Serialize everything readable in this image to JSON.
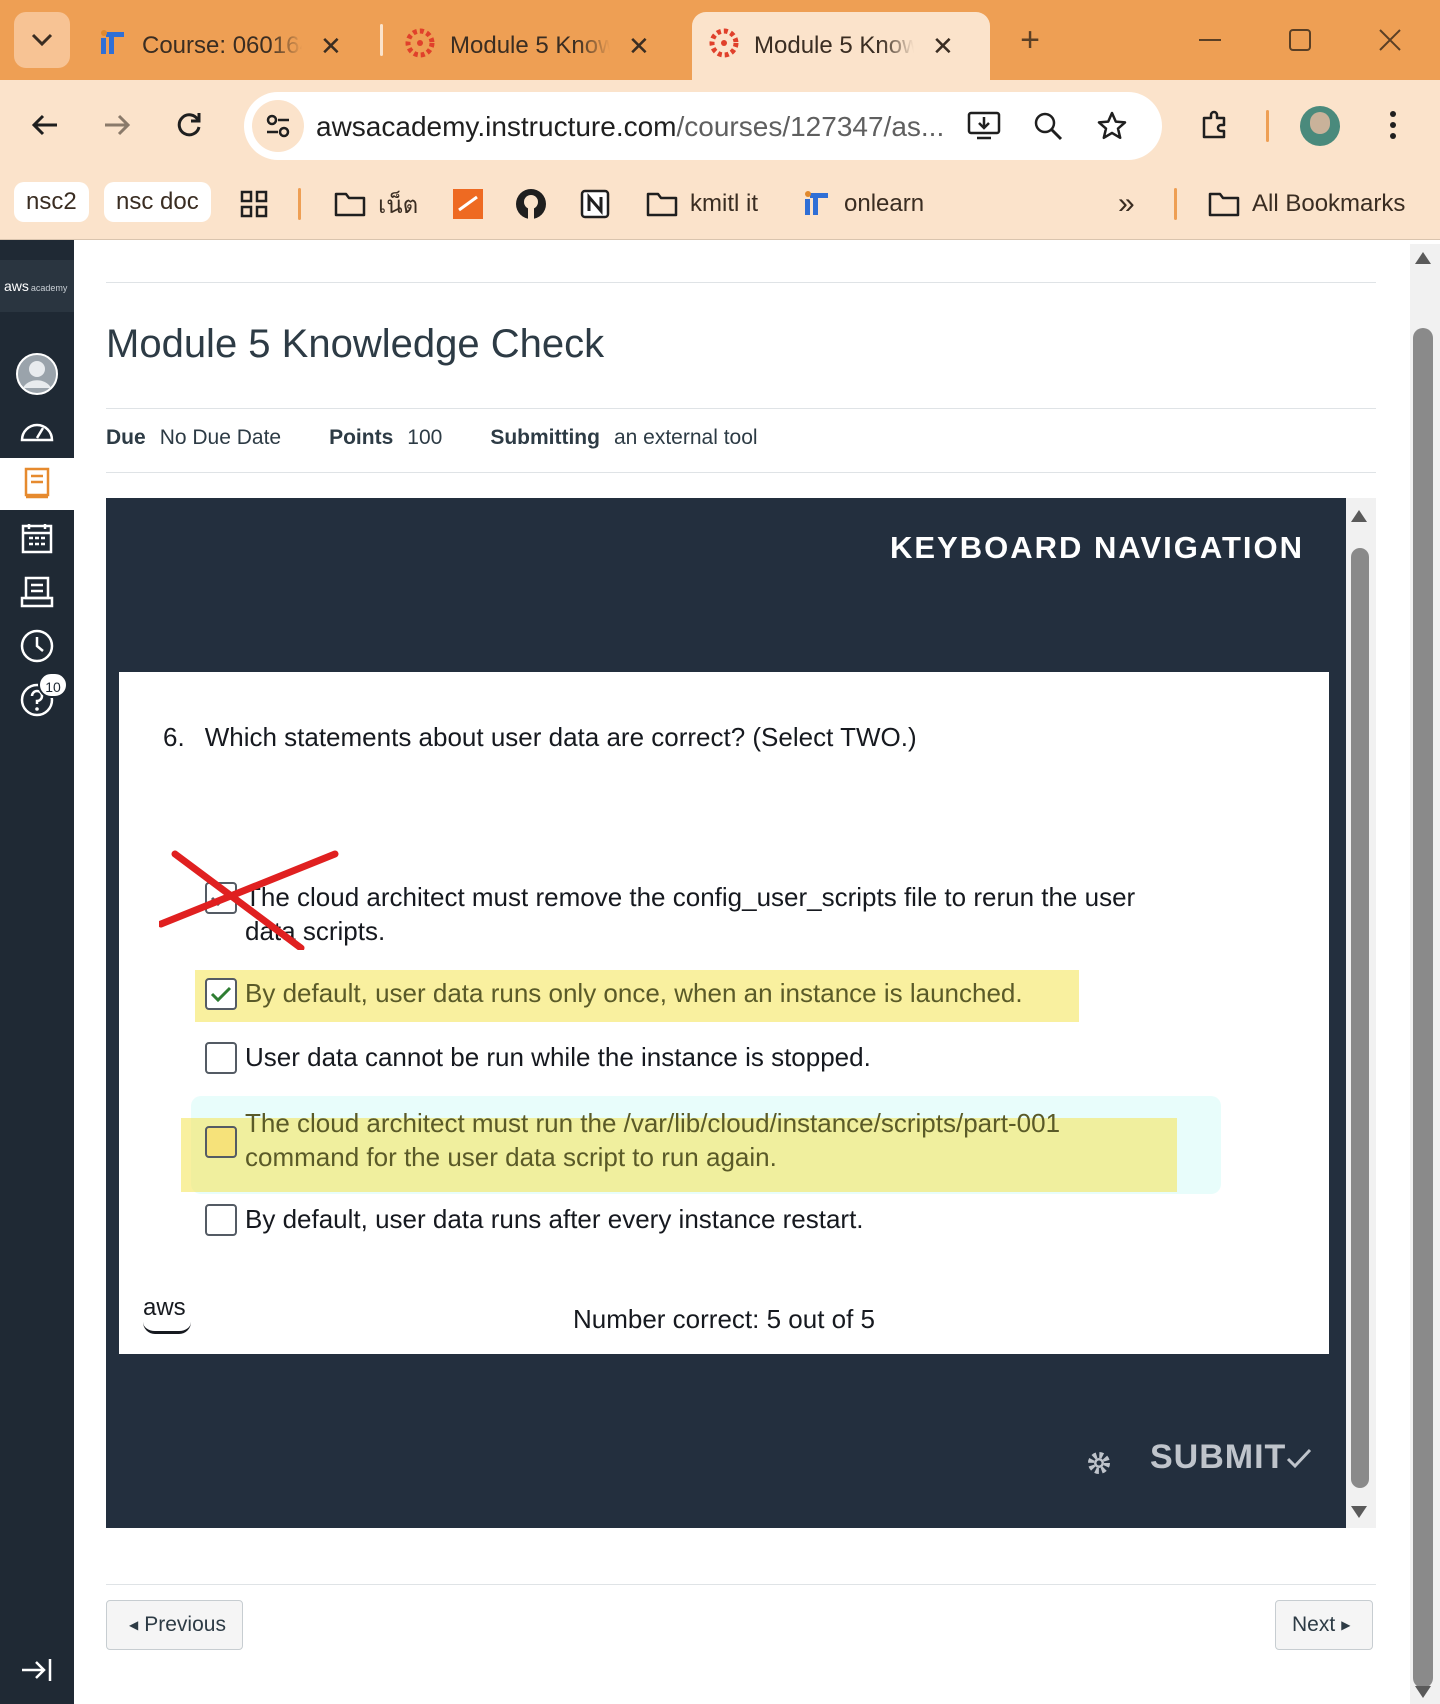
{
  "browser": {
    "tabs": [
      {
        "title": "Course: 060164",
        "icon": "it-logo-icon"
      },
      {
        "title": "Module 5 Know",
        "icon": "canvas-logo-icon"
      },
      {
        "title": "Module 5 Know",
        "icon": "canvas-logo-icon",
        "active": true
      }
    ],
    "new_tab": "+",
    "url_host": "awsacademy.instructure.com",
    "url_path": "/courses/127347/as...",
    "bookmarks": {
      "chip1": "nsc2",
      "chip2": "nsc doc",
      "folder1": "เน็ต",
      "kmitl": "kmitl it",
      "onlearn": "onlearn",
      "more": "»",
      "all": "All Bookmarks"
    },
    "colors": {
      "tabstrip": "#ee9f54",
      "toolbar": "#fbe3cb"
    }
  },
  "sidebar": {
    "logo": "aws",
    "logo_sub": "academy",
    "help_badge": "10"
  },
  "assignment": {
    "title": "Module 5 Knowledge Check",
    "due_label": "Due",
    "due_value": "No Due Date",
    "points_label": "Points",
    "points_value": "100",
    "submitting_label": "Submitting",
    "submitting_value": "an external tool"
  },
  "quiz": {
    "keyboard_nav": "KEYBOARD NAVIGATION",
    "question_number": "6.",
    "question_text": "Which statements about user data are correct? (Select TWO.)",
    "options": [
      {
        "text": "The cloud architect must remove the config_user_scripts file to rerun the user data scripts.",
        "checked": true,
        "annotation": "crossed-out"
      },
      {
        "text": "By default, user data runs only once, when an instance is launched.",
        "checked": true,
        "annotation": "highlighted"
      },
      {
        "text": "User data cannot be run while the instance is stopped.",
        "checked": false
      },
      {
        "text": "The cloud architect must run the /var/lib/cloud/instance/scripts/part-001 command for the user data script to run again.",
        "checked": false,
        "annotation": "highlighted"
      },
      {
        "text": "By default, user data runs after every instance restart.",
        "checked": false
      }
    ],
    "brand": "aws",
    "score": "Number correct: 5 out of 5",
    "submit": "SUBMIT"
  },
  "pager": {
    "previous": "Previous",
    "next": "Next"
  }
}
